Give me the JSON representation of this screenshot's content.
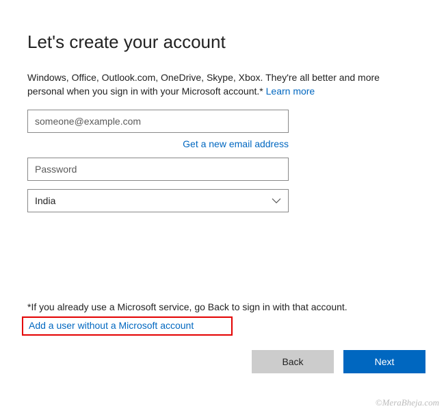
{
  "heading": "Let's create your account",
  "intro": {
    "text": "Windows, Office, Outlook.com, OneDrive, Skype, Xbox. They're all better and more personal when you sign in with your Microsoft account.* ",
    "learn_more": "Learn more"
  },
  "form": {
    "email_placeholder": "someone@example.com",
    "get_new_email": "Get a new email address",
    "password_placeholder": "Password",
    "country_selected": "India"
  },
  "footnote": "*If you already use a Microsoft service, go Back to sign in with that account.",
  "add_user_link": "Add a user without a Microsoft account",
  "buttons": {
    "back": "Back",
    "next": "Next"
  },
  "watermark": "©MeraBheja.com"
}
